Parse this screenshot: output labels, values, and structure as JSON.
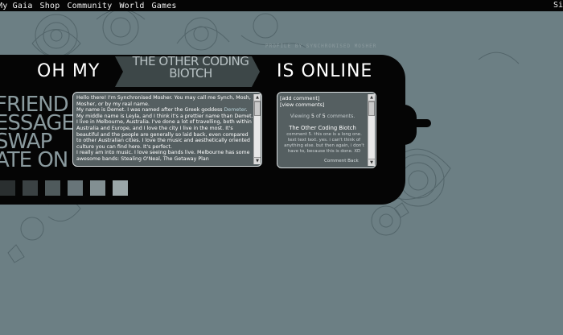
{
  "nav": {
    "items": [
      "My Gaia",
      "Shop",
      "Community",
      "World",
      "Games"
    ],
    "edge_label": "Si"
  },
  "header": {
    "title_left": "OH MY",
    "banner_line1": "THE OTHER CODING",
    "banner_line2": "BIOTCH",
    "title_right": "IS ONLINE",
    "credit": "PROFILE BY SYNCHRONISED MOSHER"
  },
  "side_words": [
    "FRIEND",
    "ESSAGE",
    "SWAP",
    "ATE ON"
  ],
  "about": {
    "paragraphs": [
      "Hello there! I'm Synchronised Mosher. You may call me Synch, Mosh, Mosher, or by my real name.",
      "My name is Demet. I was named after the Greek goddess Demeter. My middle name is Leyla, and I think it's a prettier name than Demet.",
      "I live in Melbourne, Australia. I've done a lot of travelling, both within Australia and Europe, and I love the city I live in the most. It's beautiful and the people are generally so laid back, even compared to other Australian cities. I love the music and aesthetically oriented culture you can find here. It's perfect.",
      "I really am into music. I love seeing bands live. Melbourne has some awesome bands: Stealing O'Neal, The Getaway Plan"
    ],
    "highlight_word": "Demeter"
  },
  "comments": {
    "add_label": "[add comment]",
    "view_label": "[view comments]",
    "viewing_prefix": "Viewing",
    "viewing_from": "5",
    "viewing_of": "of",
    "viewing_total": "5",
    "viewing_suffix": "comments.",
    "author": "The Other Coding Biotch",
    "body": "comment 5. this one is a long one. text text text. yes. i can't think of anything else. but then again, i don't have to, because this is done. XD",
    "back_label": "Comment Back"
  },
  "colors": {
    "background": "#6c7f84",
    "band": "#050505",
    "panel": "#555f61",
    "swatches": [
      "#2a2f30",
      "#3b4244",
      "#4f5a5c",
      "#687579",
      "#828f92",
      "#9aa6a8"
    ]
  }
}
